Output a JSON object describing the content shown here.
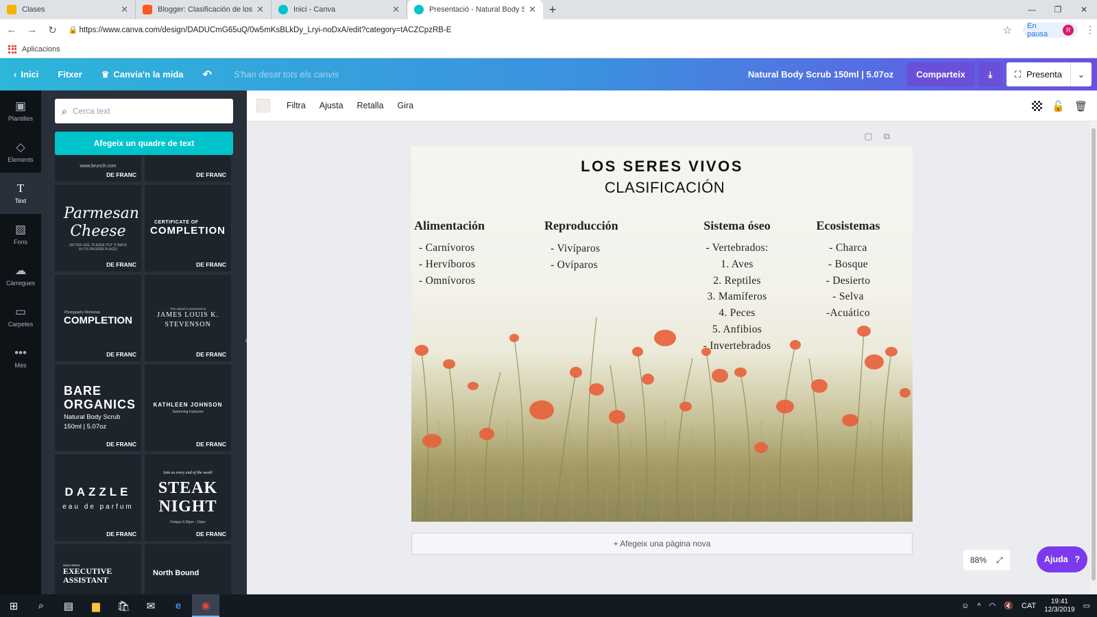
{
  "browser": {
    "tabs": [
      {
        "title": "Clases",
        "color": "#f4b400"
      },
      {
        "title": "Blogger: Clasificación de los sere",
        "color": "#ff5722"
      },
      {
        "title": "Inici - Canva",
        "color": "#00c4cc"
      },
      {
        "title": "Presentació - Natural Body Scrub",
        "color": "#00c4cc"
      }
    ],
    "url": "https://www.canva.com/design/DADUCmG65uQ/0w5mKsBLkDy_Lryi-noDxA/edit?category=tACZCpzRB-E",
    "pause_label": "En pausa",
    "avatar_letter": "R",
    "bookmarks_label": "Aplicacions"
  },
  "topbar": {
    "home": "Inici",
    "file": "Fitxer",
    "resize": "Canvia'n la mida",
    "saved": "S'han desat tots els canvis",
    "doc_name": "Natural Body Scrub 150ml | 5.07oz",
    "share": "Comparteix",
    "present": "Presenta"
  },
  "leftnav": [
    {
      "label": "Plantilles",
      "icon": "template-icon"
    },
    {
      "label": "Elements",
      "icon": "shapes-icon"
    },
    {
      "label": "Text",
      "icon": "text-icon"
    },
    {
      "label": "Fons",
      "icon": "background-icon"
    },
    {
      "label": "Càrregues",
      "icon": "upload-icon"
    },
    {
      "label": "Carpetes",
      "icon": "folder-icon"
    },
    {
      "label": "Més",
      "icon": "more-icon"
    }
  ],
  "panel": {
    "search_placeholder": "Cerca text",
    "add_text": "Afegeix un quadre de text",
    "badge": "DE FRANC",
    "tiles": {
      "top_left": "www.brunch.com",
      "parmesan": "Parmesan Cheese",
      "parmesan_small": "(AFTER USE, PLEASE PUT IT BACK IN ITS PROPER PLACE)",
      "cert_small": "CERTIFICATE OF",
      "cert_large": "COMPLETION",
      "photo_small": "Photography Workshop",
      "photo_large": "COMPLETION",
      "james_small": "This award is presented to",
      "james_large": "JAMES LOUIS K. STEVENSON",
      "bare_large": "BARE ORGANICS",
      "bare_small": "Natural Body Scrub 150ml | 5.07oz",
      "kath_large": "KATHLEEN JOHNSON",
      "kath_small": "Swimming Instructor",
      "dazzle_large": "DAZZLE",
      "dazzle_small": "eau de parfum",
      "steak_small": "Join us every end of the week!",
      "steak_large": "STEAK NIGHT",
      "steak_date": "Fridays 6:30pm - 10pm",
      "exec_small": "NOW HIRING",
      "exec_large": "EXECUTIVE ASSISTANT",
      "north_large": "North Bound"
    }
  },
  "editbar": {
    "filter": "Filtra",
    "adjust": "Ajusta",
    "crop": "Retalla",
    "flip": "Gira"
  },
  "slide": {
    "title": "LOS SERES VIVOS",
    "subtitle": "CLASIFICACIÓN",
    "columns": [
      {
        "heading": "Alimentación",
        "items": [
          "- Carnívoros",
          "- Hervíboros",
          "- Omnívoros"
        ]
      },
      {
        "heading": "Reproducción",
        "items": [
          "- Vivíparos",
          "- Ovíparos"
        ]
      },
      {
        "heading": "Sistema óseo",
        "items": [
          "- Vertebrados:",
          "1. Aves",
          "2. Reptiles",
          "3. Mamíferos",
          "4. Peces",
          "5. Anfibios",
          "- Invertebrados"
        ]
      },
      {
        "heading": "Ecosistemas",
        "items": [
          "- Charca",
          "- Bosque",
          "- Desierto",
          "- Selva",
          "-Acuático"
        ]
      }
    ]
  },
  "add_page": "+ Afegeix una pàgina nova",
  "zoom": "88%",
  "help": "Ajuda",
  "taskbar": {
    "lang": "CAT",
    "time": "19:41",
    "date": "12/3/2019"
  }
}
